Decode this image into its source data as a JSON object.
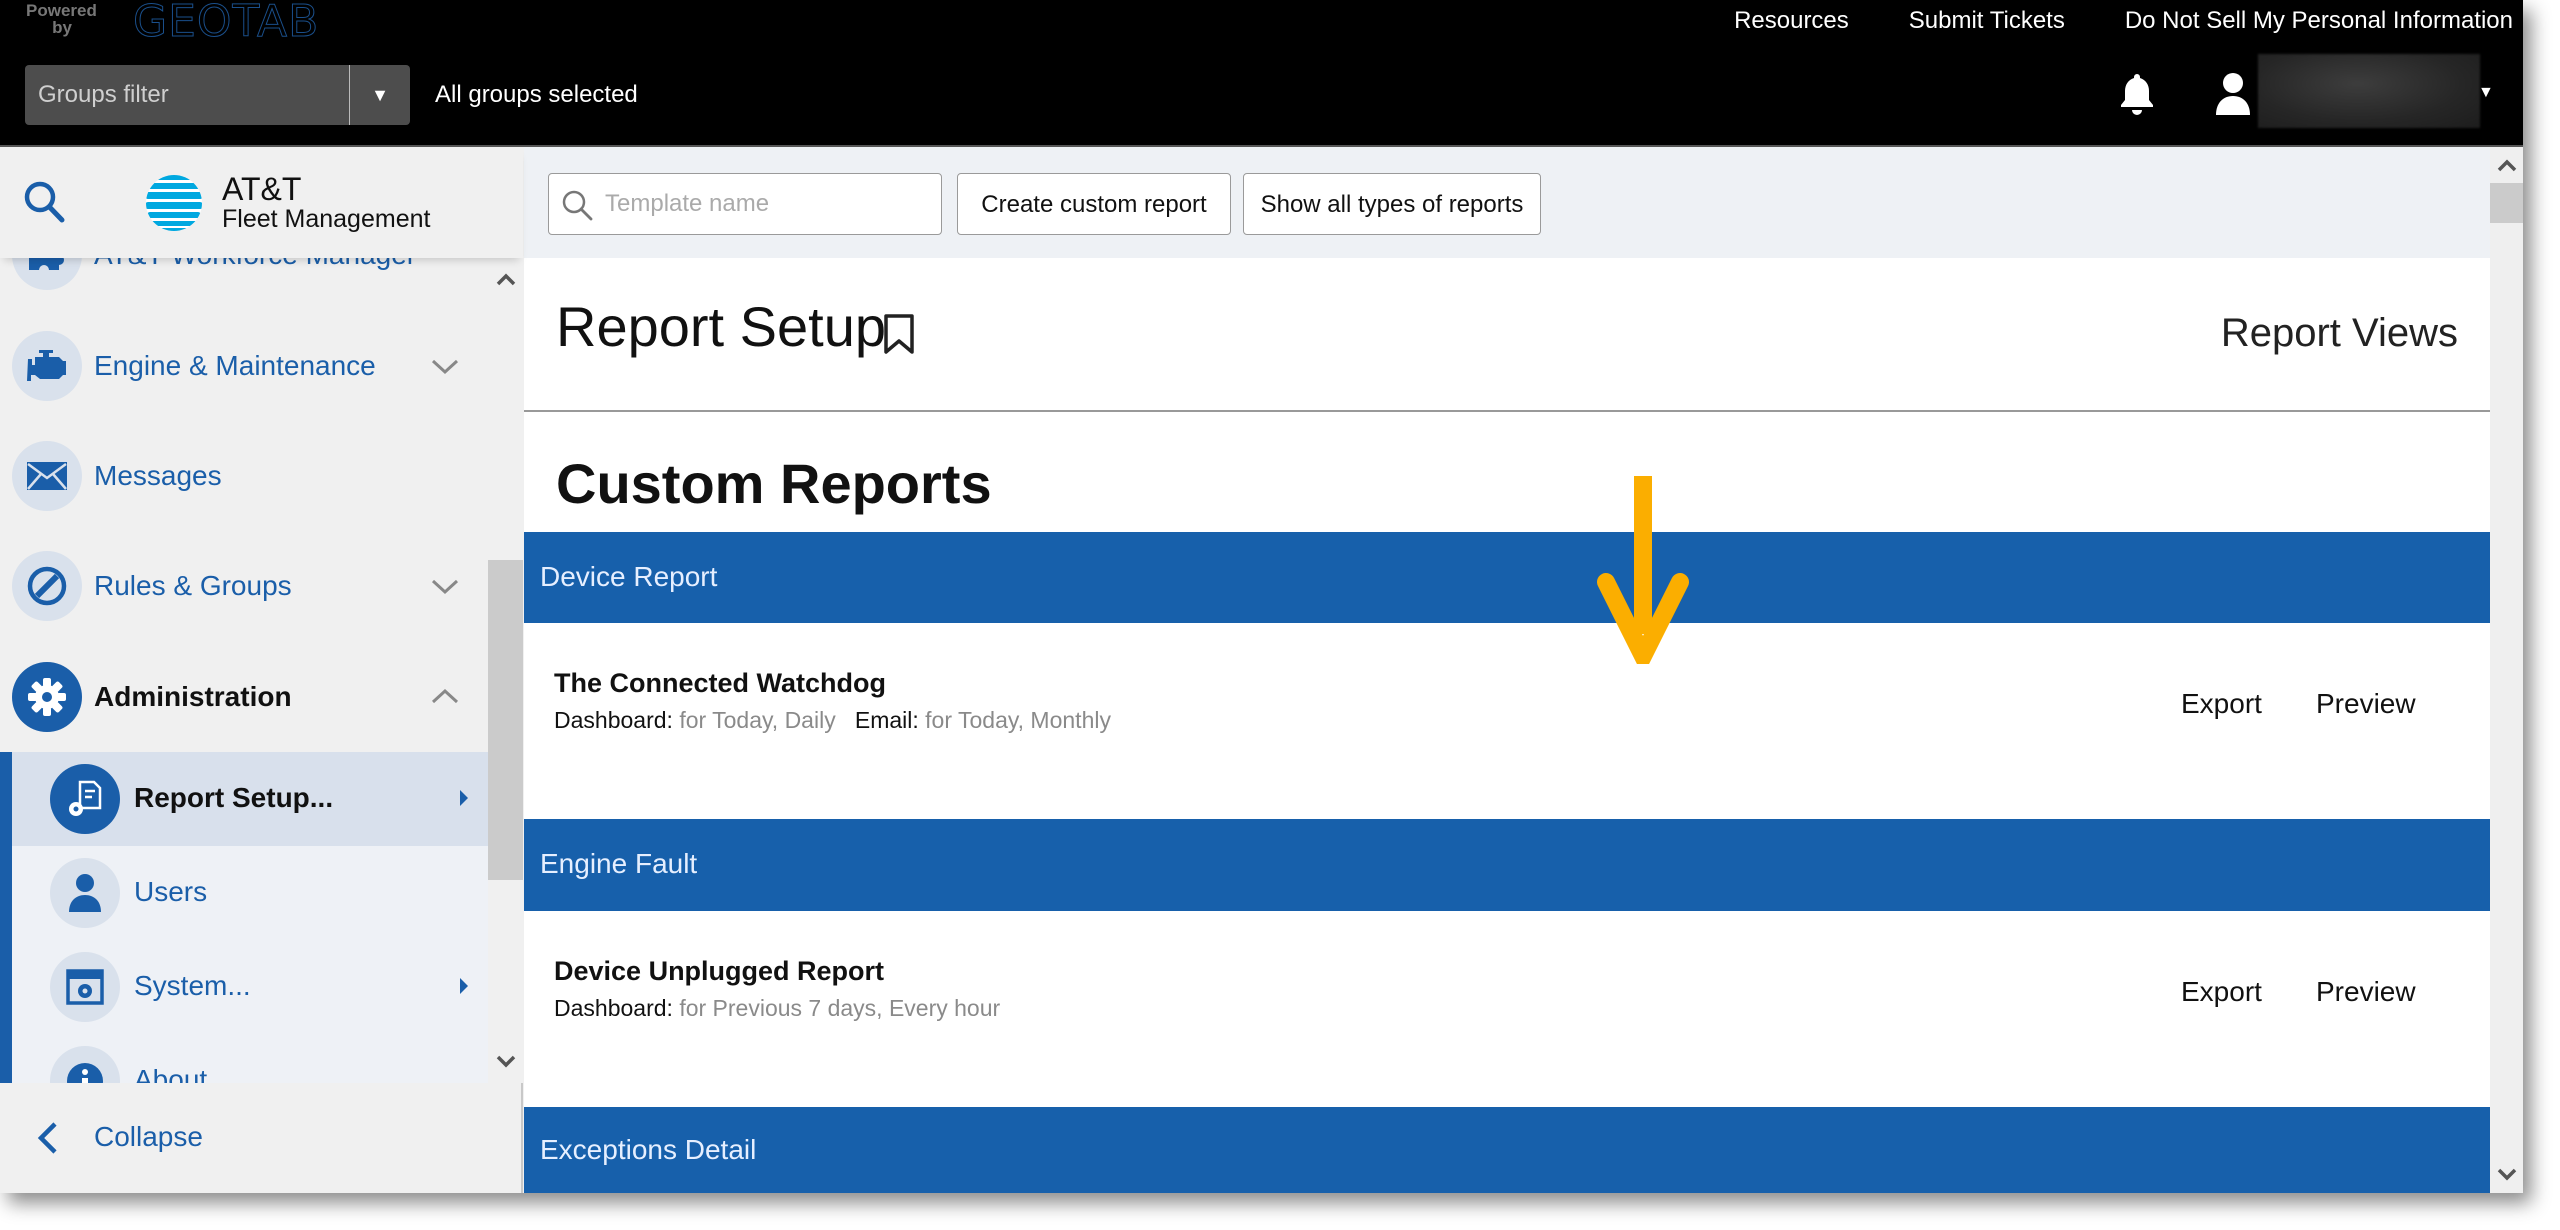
{
  "header": {
    "powered_by": "Powered by",
    "brand": "GEOTAB",
    "links": [
      "Resources",
      "Submit Tickets",
      "Do Not Sell My Personal Information"
    ],
    "groups_filter": {
      "placeholder": "Groups filter",
      "status": "All groups selected"
    },
    "icons": {
      "notifications": "bell-icon",
      "user": "user-icon",
      "menu": "caret-down-icon"
    }
  },
  "sidebar": {
    "logo": {
      "title": "AT&T",
      "subtitle": "Fleet Management"
    },
    "items": [
      {
        "label": "AT&T Workforce Manager",
        "icon": "puzzle-icon",
        "partial": true
      },
      {
        "label": "Engine & Maintenance",
        "icon": "engine-icon",
        "chevron": "down"
      },
      {
        "label": "Messages",
        "icon": "envelope-icon"
      },
      {
        "label": "Rules & Groups",
        "icon": "rules-icon",
        "chevron": "down"
      },
      {
        "label": "Administration",
        "icon": "gear-icon",
        "chevron": "up",
        "expanded": true
      }
    ],
    "admin_sub": [
      {
        "label": "Report Setup...",
        "icon": "report-setup-icon",
        "selected": true,
        "submenu": true
      },
      {
        "label": "Users",
        "icon": "user-icon"
      },
      {
        "label": "System...",
        "icon": "system-settings-icon",
        "submenu": true
      },
      {
        "label": "About",
        "icon": "info-icon",
        "partial": true
      }
    ],
    "collapse_label": "Collapse"
  },
  "toolbar": {
    "search_placeholder": "Template name",
    "search_value": "",
    "create_label": "Create custom report",
    "show_all_label": "Show all types of reports"
  },
  "page": {
    "title": "Report Setup",
    "report_views_label": "Report Views",
    "section_title": "Custom Reports"
  },
  "report_groups": [
    {
      "category": "Device Report",
      "reports": [
        {
          "name": "The Connected Watchdog",
          "dashboard_label": "Dashboard:",
          "dashboard_value": "for Today, Daily",
          "email_label": "Email:",
          "email_value": "for Today, Monthly",
          "actions": [
            "Export",
            "Preview"
          ]
        }
      ]
    },
    {
      "category": "Engine Fault",
      "reports": [
        {
          "name": "Device Unplugged Report",
          "dashboard_label": "Dashboard:",
          "dashboard_value": "for Previous 7 days, Every hour",
          "actions": [
            "Export",
            "Preview"
          ]
        }
      ]
    },
    {
      "category": "Exceptions Detail",
      "reports": []
    }
  ],
  "colors": {
    "brand_blue": "#1760ab",
    "sidebar_bg": "#f0f0f0",
    "header_bg": "#000000",
    "annotation_arrow": "#fbae00"
  },
  "annotation": {
    "type": "arrow",
    "direction": "down",
    "color": "#fbae00"
  }
}
